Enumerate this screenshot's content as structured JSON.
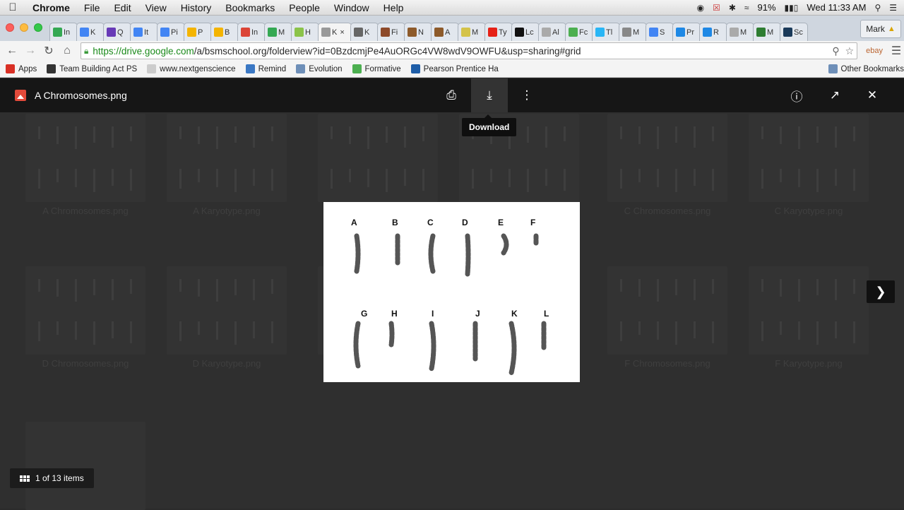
{
  "menubar": {
    "apple_icon": "apple-icon",
    "items": [
      "Chrome",
      "File",
      "Edit",
      "View",
      "History",
      "Bookmarks",
      "People",
      "Window",
      "Help"
    ],
    "battery": "91%",
    "clock": "Wed 11:33 AM"
  },
  "tabs": [
    {
      "label": "In",
      "color": "#34a853"
    },
    {
      "label": "K",
      "color": "#4285f4"
    },
    {
      "label": "Q",
      "color": "#673ab7"
    },
    {
      "label": "It",
      "color": "#4285f4"
    },
    {
      "label": "Pi",
      "color": "#4285f4"
    },
    {
      "label": "P",
      "color": "#f4b400"
    },
    {
      "label": "B",
      "color": "#f4b400"
    },
    {
      "label": "In",
      "color": "#db4437"
    },
    {
      "label": "M",
      "color": "#34a853"
    },
    {
      "label": "H",
      "color": "#8bc34a"
    },
    {
      "label": "K",
      "color": "#999999",
      "active": true
    },
    {
      "label": "K",
      "color": "#666666"
    },
    {
      "label": "Fi",
      "color": "#8d4a2a"
    },
    {
      "label": "N",
      "color": "#8d5a2a"
    },
    {
      "label": "A",
      "color": "#8d5a2a"
    },
    {
      "label": "M",
      "color": "#d4c34a"
    },
    {
      "label": "Ty",
      "color": "#e62117"
    },
    {
      "label": "Lc",
      "color": "#111111"
    },
    {
      "label": "Al",
      "color": "#aaaaaa"
    },
    {
      "label": "Fc",
      "color": "#4caf50"
    },
    {
      "label": "Tl",
      "color": "#29b6f6"
    },
    {
      "label": "M",
      "color": "#888888"
    },
    {
      "label": "S",
      "color": "#4285f4"
    },
    {
      "label": "Pr",
      "color": "#1e88e5"
    },
    {
      "label": "R",
      "color": "#1e88e5"
    },
    {
      "label": "M",
      "color": "#aaaaaa"
    },
    {
      "label": "M",
      "color": "#2e7d32"
    },
    {
      "label": "Sc",
      "color": "#1a3a5a"
    }
  ],
  "profile_name": "Mark",
  "omnibox": {
    "url_scheme": "https://",
    "url_host": "drive.google.com",
    "url_rest": "/a/bsmschool.org/folderview?id=0BzdcmjPe4AuORGc4VW8wdV9OWFU&usp=sharing#grid"
  },
  "ext_label": "ebay",
  "bookmarks": [
    {
      "label": "Apps",
      "color": "#d93025"
    },
    {
      "label": "Team Building Act PS",
      "color": "#333333"
    },
    {
      "label": "www.nextgenscience",
      "color": "#cccccc"
    },
    {
      "label": "Remind",
      "color": "#3b78c4"
    },
    {
      "label": "Evolution",
      "color": "#6e8fb8"
    },
    {
      "label": "Formative",
      "color": "#4caf50"
    },
    {
      "label": "Pearson Prentice Ha",
      "color": "#1f5ea8"
    }
  ],
  "other_bookmarks": "Other Bookmarks",
  "viewer": {
    "file_name": "A Chromosomes.png",
    "tooltip": "Download",
    "counter": "1 of 13 items",
    "thumb_labels": [
      "A Chromosomes.png",
      "A Karyotype.png",
      "",
      "",
      "C Chromosomes.png",
      "C Karyotype.png",
      "D Chromosomes.png",
      "D Karyotype.png",
      "",
      "",
      "F Chromosomes.png",
      "F Karyotype.png"
    ]
  },
  "chromosome_labels": {
    "row1": [
      "A",
      "B",
      "C",
      "D",
      "E",
      "F"
    ],
    "row2": [
      "G",
      "H",
      "I",
      "J",
      "K",
      "L"
    ]
  }
}
